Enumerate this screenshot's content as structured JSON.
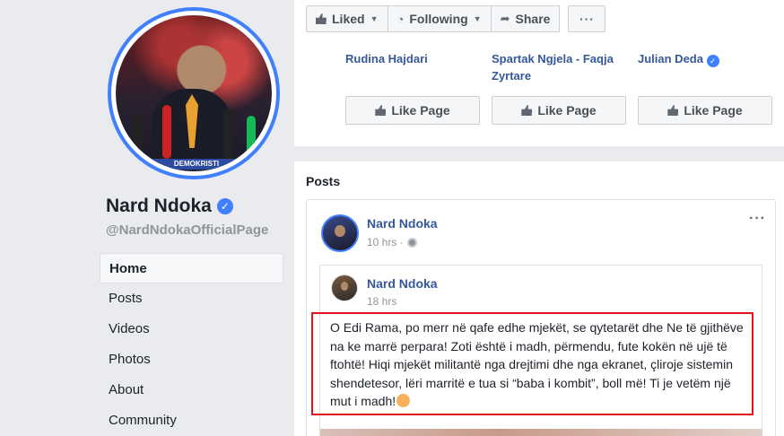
{
  "profile": {
    "name": "Nard Ndoka",
    "handle": "@NardNdokaOfficialPage",
    "photo_banner_text": "DEMOKRISTI",
    "verified_icon": "verified-badge-icon"
  },
  "nav": {
    "items": [
      {
        "label": "Home",
        "active": true
      },
      {
        "label": "Posts"
      },
      {
        "label": "Videos"
      },
      {
        "label": "Photos"
      },
      {
        "label": "About"
      },
      {
        "label": "Community"
      }
    ]
  },
  "actions": {
    "liked": "Liked",
    "following": "Following",
    "share": "Share",
    "more": "···"
  },
  "suggestions": [
    {
      "name": "Rudina Hajdari",
      "button": "Like Page"
    },
    {
      "name": "Spartak Ngjela - Faqja Zyrtare",
      "button": "Like Page"
    },
    {
      "name": "Julian Deda",
      "button": "Like Page",
      "verified": true
    }
  ],
  "posts": {
    "title": "Posts",
    "post": {
      "author": "Nard Ndoka",
      "time": "10 hrs ·",
      "more": "···",
      "shared": {
        "author": "Nard Ndoka",
        "time": "18 hrs",
        "text": "O Edi Rama, po merr në qafe edhe mjekët, se qytetarët dhe Ne të gjithëve na ke marrë perpara! Zoti është i madh, përmendu, fute kokën në ujë të ftohtë! Hiqi mjekët militantë nga drejtimi dhe nga ekranet, çliroje sistemin shendetesor, lëri marritë e tua si “baba i kombit”, boll më! Ti je vetëm një mut i madh!"
      }
    }
  },
  "colors": {
    "accent": "#4080ff",
    "link": "#365899",
    "highlight_border": "#e0151b",
    "background": "#e9ebee"
  }
}
